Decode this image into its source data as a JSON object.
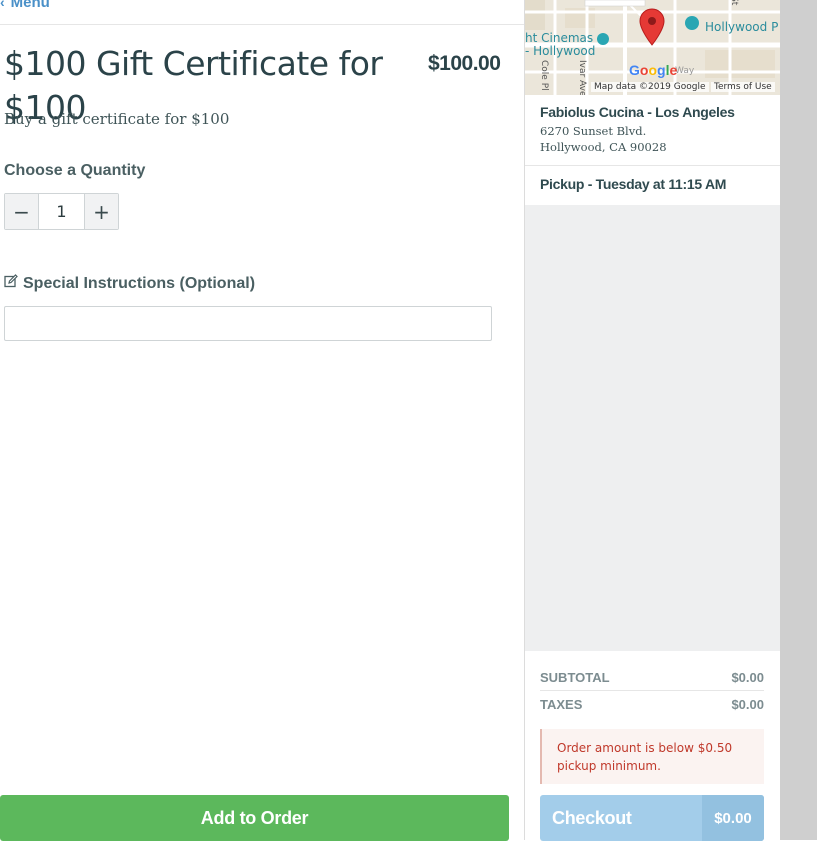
{
  "nav": {
    "back_label": "Menu"
  },
  "item": {
    "title": "$100 Gift Certificate for $100",
    "price": "$100.00",
    "description": "Buy a gift certificate for $100"
  },
  "quantity": {
    "label": "Choose a Quantity",
    "value": "1",
    "minus": "−",
    "plus": "+"
  },
  "instructions": {
    "label": "Special Instructions (Optional)",
    "value": "",
    "placeholder": ""
  },
  "add_button": {
    "label": "Add to Order"
  },
  "map": {
    "labels": {
      "cinemas_1": "ht Cinemas",
      "cinemas_2": "- Hollywood",
      "hollywood_p": "Hollywood P",
      "cole_pl": "Cole Pl",
      "ivar_ave": "Ivar Ave",
      "st": "St",
      "way": "Way"
    },
    "google": [
      "G",
      "o",
      "o",
      "g",
      "l",
      "e"
    ],
    "attribution": "Map data ©2019 Google",
    "terms": "Terms of Use"
  },
  "restaurant": {
    "name": "Fabiolus Cucina - Los Angeles",
    "address_line1": "6270 Sunset Blvd.",
    "address_line2": "Hollywood, CA 90028",
    "pickup": "Pickup - Tuesday at 11:15 AM"
  },
  "totals": {
    "subtotal_label": "SUBTOTAL",
    "subtotal_value": "$0.00",
    "taxes_label": "TAXES",
    "taxes_value": "$0.00"
  },
  "alert": {
    "message": "Order amount is below $0.50 pickup minimum."
  },
  "checkout": {
    "label": "Checkout",
    "amount": "$0.00"
  },
  "colors": {
    "primary_green": "#5cb85c",
    "checkout_blue": "#a3cdea",
    "alert_red": "#c0392b",
    "link_blue": "#4a90c8"
  }
}
